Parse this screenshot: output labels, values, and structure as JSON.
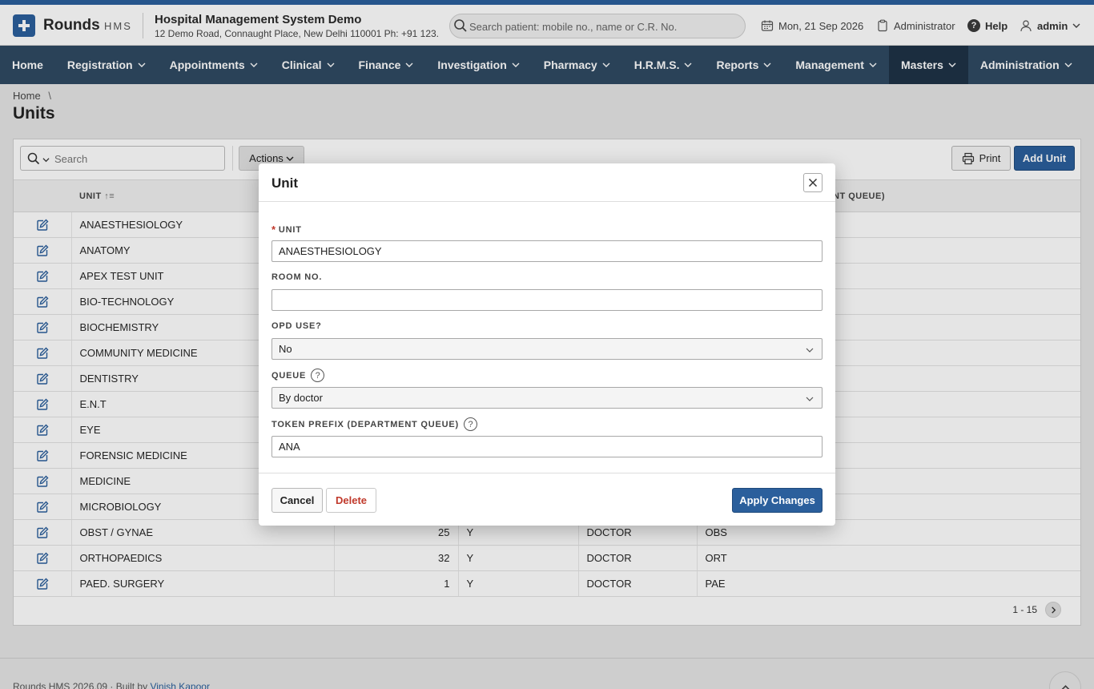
{
  "header": {
    "brand": "Rounds",
    "brand_sub": "HMS",
    "org_title": "Hospital Management System Demo",
    "org_address": "12 Demo Road, Connaught Place, New Delhi 110001 Ph: +91 123...",
    "search_placeholder": "Search patient: mobile no., name or C.R. No.",
    "date": "Mon, 21 Sep 2026",
    "role": "Administrator",
    "help": "Help",
    "user": "admin"
  },
  "nav": {
    "items": [
      {
        "label": "Home"
      },
      {
        "label": "Registration"
      },
      {
        "label": "Appointments"
      },
      {
        "label": "Clinical"
      },
      {
        "label": "Finance"
      },
      {
        "label": "Investigation"
      },
      {
        "label": "Pharmacy"
      },
      {
        "label": "H.R.M.S."
      },
      {
        "label": "Reports"
      },
      {
        "label": "Management"
      },
      {
        "label": "Masters"
      },
      {
        "label": "Administration"
      }
    ]
  },
  "breadcrumb": {
    "home": "Home",
    "sep": "\\"
  },
  "page": {
    "title": "Units"
  },
  "toolbar": {
    "search_placeholder": "Search",
    "actions": "Actions",
    "print": "Print",
    "add": "Add Unit"
  },
  "table": {
    "headers": {
      "unit": "UNIT",
      "token_prefix_tail": "NT QUEUE)"
    },
    "rows": [
      {
        "unit": "ANAESTHESIOLOGY",
        "room": "",
        "opd": "",
        "queue": "",
        "prefix": ""
      },
      {
        "unit": "ANATOMY",
        "room": "",
        "opd": "",
        "queue": "",
        "prefix": ""
      },
      {
        "unit": "APEX TEST UNIT",
        "room": "",
        "opd": "",
        "queue": "",
        "prefix": ""
      },
      {
        "unit": "BIO-TECHNOLOGY",
        "room": "",
        "opd": "",
        "queue": "",
        "prefix": ""
      },
      {
        "unit": "BIOCHEMISTRY",
        "room": "",
        "opd": "",
        "queue": "",
        "prefix": ""
      },
      {
        "unit": "COMMUNITY MEDICINE",
        "room": "",
        "opd": "",
        "queue": "",
        "prefix": ""
      },
      {
        "unit": "DENTISTRY",
        "room": "",
        "opd": "",
        "queue": "",
        "prefix": ""
      },
      {
        "unit": "E.N.T",
        "room": "",
        "opd": "",
        "queue": "",
        "prefix": ""
      },
      {
        "unit": "EYE",
        "room": "",
        "opd": "",
        "queue": "",
        "prefix": ""
      },
      {
        "unit": "FORENSIC MEDICINE",
        "room": "",
        "opd": "",
        "queue": "",
        "prefix": ""
      },
      {
        "unit": "MEDICINE",
        "room": "",
        "opd": "",
        "queue": "",
        "prefix": ""
      },
      {
        "unit": "MICROBIOLOGY",
        "room": "",
        "opd": "",
        "queue": "",
        "prefix": ""
      },
      {
        "unit": "OBST / GYNAE",
        "room": "25",
        "opd": "Y",
        "queue": "DOCTOR",
        "prefix": "OBS"
      },
      {
        "unit": "ORTHOPAEDICS",
        "room": "32",
        "opd": "Y",
        "queue": "DOCTOR",
        "prefix": "ORT"
      },
      {
        "unit": "PAED. SURGERY",
        "room": "1",
        "opd": "Y",
        "queue": "DOCTOR",
        "prefix": "PAE"
      }
    ]
  },
  "pagination": {
    "range": "1 - 15"
  },
  "footer": {
    "version": "Rounds HMS 2026.09 · Built by",
    "author": "Vinish Kapoor"
  },
  "dialog": {
    "title": "Unit",
    "unit_label": "UNIT",
    "unit_value": "ANAESTHESIOLOGY",
    "room_label": "ROOM NO.",
    "room_value": "",
    "opd_label": "OPD USE?",
    "opd_value": "No",
    "queue_label": "QUEUE",
    "queue_value": "By doctor",
    "prefix_label": "TOKEN PREFIX (DEPARTMENT QUEUE)",
    "prefix_value": "ANA",
    "cancel": "Cancel",
    "delete": "Delete",
    "apply": "Apply Changes"
  },
  "colors": {
    "accent": "#2b5f9c",
    "nav": "#2f4a63",
    "danger": "#c0392b"
  }
}
